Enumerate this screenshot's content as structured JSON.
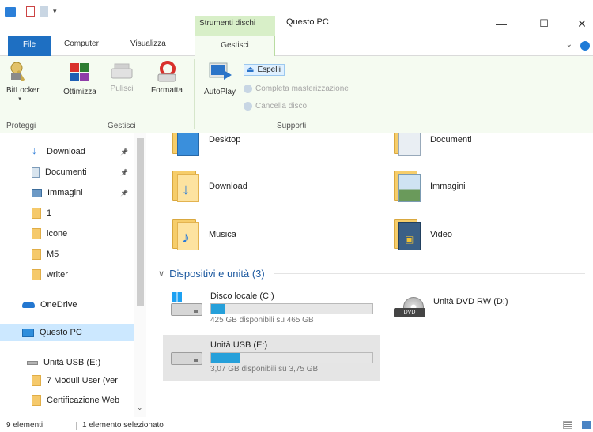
{
  "window": {
    "title": "Questo PC",
    "context_tab_header": "Strumenti dischi",
    "minimize": "—",
    "maximize": "☐",
    "close": "✕"
  },
  "quick_access_toolbar": {
    "dropdown": "▾"
  },
  "tabs": {
    "file": "File",
    "computer": "Computer",
    "visualizza": "Visualizza",
    "gestisci": "Gestisci",
    "expand_ribbon": "⌄"
  },
  "ribbon": {
    "proteggi": {
      "label": "Proteggi",
      "bitlocker": "BitLocker",
      "bitlocker_dropdown": "▾"
    },
    "gestisci": {
      "label": "Gestisci",
      "ottimizza": "Ottimizza",
      "pulisci": "Pulisci",
      "formatta": "Formatta"
    },
    "supporti": {
      "label": "Supporti",
      "autoplay": "AutoPlay",
      "espelli": "Espelli",
      "completa": "Completa masterizzazione",
      "cancella": "Cancella disco"
    }
  },
  "nav": {
    "items": [
      {
        "label": "Download",
        "pinned": true
      },
      {
        "label": "Documenti",
        "pinned": true
      },
      {
        "label": "Immagini",
        "pinned": true
      },
      {
        "label": "1"
      },
      {
        "label": "icone"
      },
      {
        "label": "M5"
      },
      {
        "label": "writer"
      },
      {
        "label": "OneDrive"
      },
      {
        "label": "Questo PC",
        "selected": true
      },
      {
        "label": "Unità USB (E:)"
      },
      {
        "label": "7 Moduli User (ver"
      },
      {
        "label": "Certificazione Web"
      }
    ],
    "pin_icon": "📌"
  },
  "content": {
    "folders": {
      "desktop": "Desktop",
      "documenti": "Documenti",
      "download": "Download",
      "immagini": "Immagini",
      "musica": "Musica",
      "video": "Video"
    },
    "devices_section": {
      "label": "Dispositivi e unità (3)",
      "chevron": "∨"
    },
    "drives": [
      {
        "name": "Disco locale (C:)",
        "free": "425 GB disponibili su 465 GB",
        "used_fraction": 0.086
      },
      {
        "name": "Unità DVD RW (D:)"
      },
      {
        "name": "Unità USB (E:)",
        "free": "3,07 GB disponibili su 3,75 GB",
        "used_fraction": 0.181
      }
    ],
    "dvd_badge": "DVD"
  },
  "status": {
    "count": "9 elementi",
    "selection": "1 elemento selezionato"
  },
  "colors": {
    "accent": "#1e6fc2",
    "context_tab": "#d8efc8",
    "ribbon_bg": "#f5fbf1",
    "selection": "#cce8ff",
    "drive_bar": "#26a0da"
  }
}
